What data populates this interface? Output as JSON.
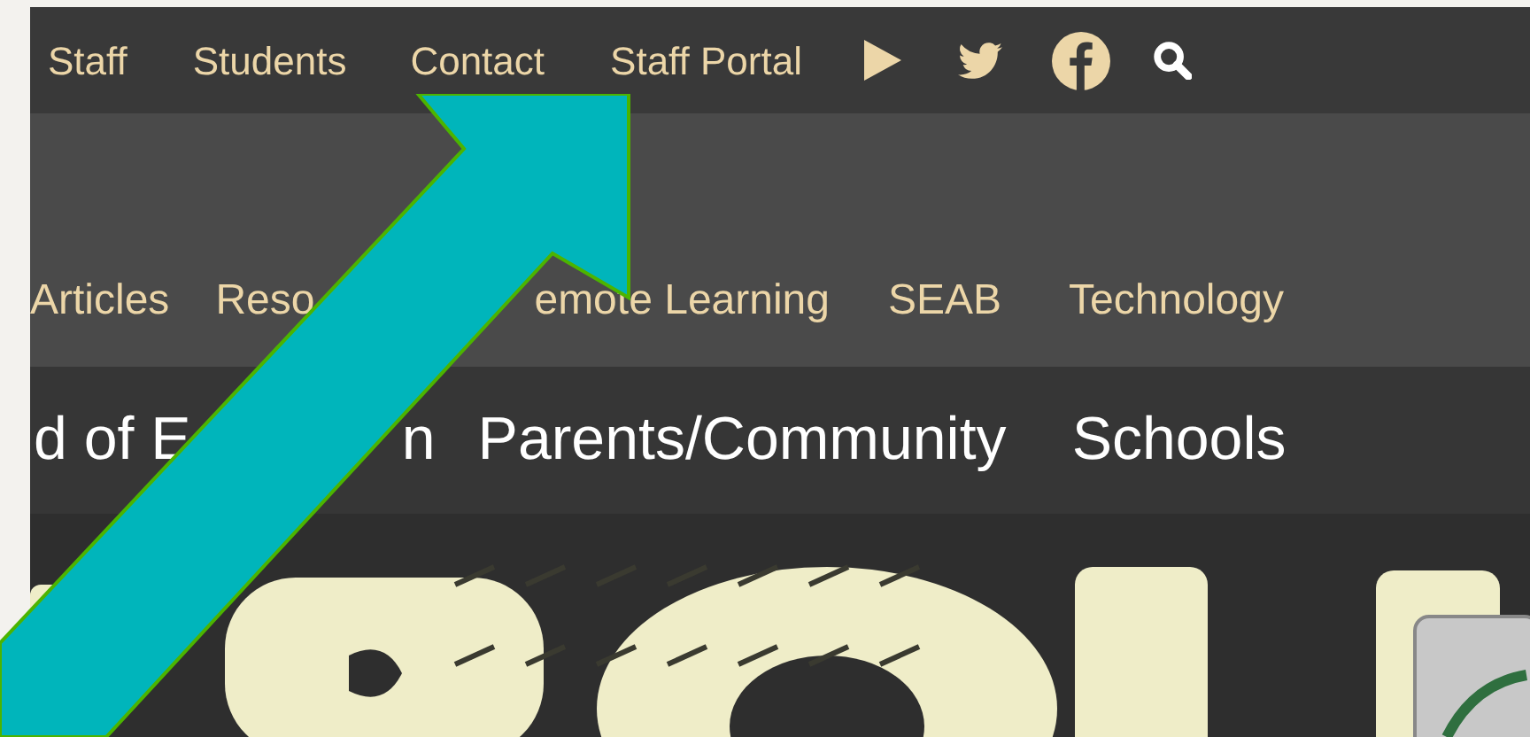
{
  "top_nav": {
    "links": [
      "Staff",
      "Students",
      "Contact",
      "Staff Portal"
    ]
  },
  "sub_nav": {
    "links": [
      "Articles",
      "Reso",
      "emote Learning",
      "SEAB",
      "Technology"
    ]
  },
  "main_nav": {
    "links": [
      "d of E",
      "n",
      "Parents/Community",
      "Schools"
    ]
  }
}
